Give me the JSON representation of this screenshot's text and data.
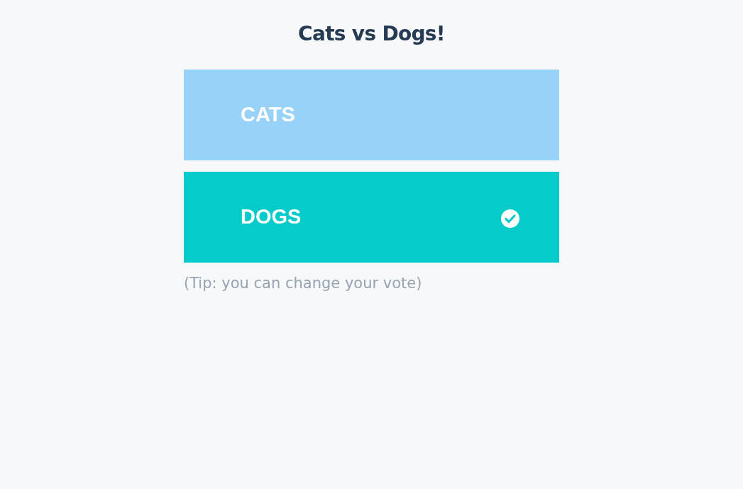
{
  "title": "Cats vs Dogs!",
  "options": [
    {
      "label": "CATS",
      "color": "#99d2f9",
      "selected": false
    },
    {
      "label": "DOGS",
      "color": "#06cbcb",
      "selected": true
    }
  ],
  "tip": "(Tip: you can change your vote)"
}
